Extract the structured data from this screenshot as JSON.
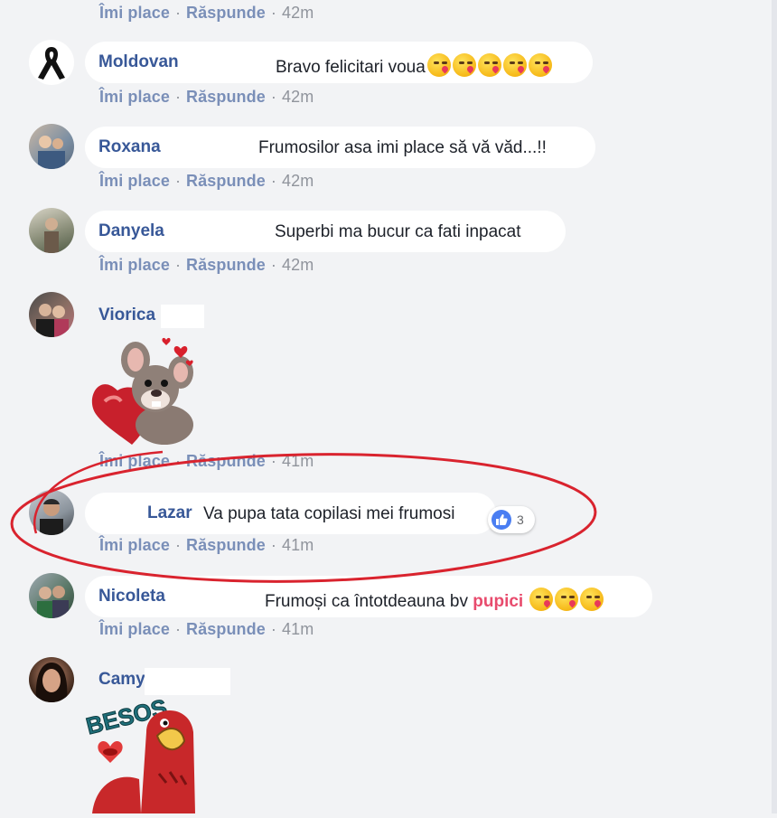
{
  "actions": {
    "like_label": "Îmi place",
    "reply_label": "Răspunde",
    "separator": "·"
  },
  "top_partial": {
    "time": "42m"
  },
  "comments": [
    {
      "name": "Moldovan",
      "text": "Bravo felicitari voua",
      "emoji_count": 5,
      "time": "42m"
    },
    {
      "name": "Roxana",
      "text": "Frumosilor asa imi place să vă văd...!!",
      "time": "42m"
    },
    {
      "name": "Danyela",
      "text": "Superbi ma bucur ca fati inpacat",
      "time": "42m"
    },
    {
      "name": "Viorica",
      "sticker": "mouse-heart-sticker",
      "time": "41m"
    },
    {
      "name": "Lazar",
      "text": "Va pupa tata copilasi mei frumosi",
      "reaction_count": "3",
      "time": "41m"
    },
    {
      "name": "Nicoleta",
      "text": "Frumoși ca întotdeauna bv",
      "highlight": "pupici",
      "emoji_count": 3,
      "time": "41m"
    },
    {
      "name": "Camy",
      "sticker": "besos-bird-sticker",
      "sticker_text": "BESOS"
    }
  ],
  "colors": {
    "name": "#385898",
    "accent_ring": "#d9232e",
    "like_blue": "#4a7ef2",
    "highlight_pink": "#e84b6d"
  }
}
